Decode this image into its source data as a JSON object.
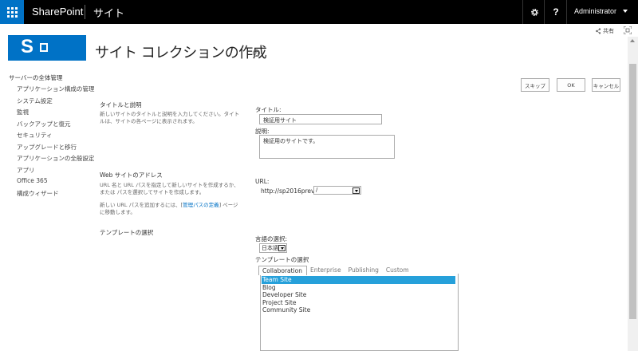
{
  "suitebar": {
    "brand": "SharePoint",
    "site": "サイト",
    "user": "Administrator",
    "help": "?"
  },
  "share_label": "共有",
  "page": {
    "title": "サイト コレクションの作成",
    "info_glyph": "i"
  },
  "leftnav": {
    "heading": "サーバーの全体管理",
    "items": [
      "アプリケーション構成の管理",
      "システム設定",
      "監視",
      "バックアップと復元",
      "セキュリティ",
      "アップグレードと移行",
      "アプリケーションの全般設定",
      "アプリ",
      "Office 365",
      "構成ウィザード"
    ]
  },
  "actions": {
    "skip": "スキップ",
    "ok": "OK",
    "cancel": "キャンセル"
  },
  "sections": {
    "title_desc": {
      "heading": "タイトルと説明",
      "description": "新しいサイトのタイトルと説明を入力してください。タイトルは、サイトの各ページに表示されます。"
    },
    "web_address": {
      "heading": "Web サイトのアドレス",
      "description": "URL 名と URL パスを指定して新しいサイトを作成するか、または パスを選択してサイトを作成します。",
      "description2_pre": "新しい URL パスを追加するには、[",
      "description2_link": "管理パスの定義",
      "description2_post": "] ページに移動します。"
    },
    "template": {
      "heading": "テンプレートの選択"
    }
  },
  "form": {
    "title_label": "タイトル:",
    "title_value": "検証用サイト",
    "desc_label": "説明:",
    "desc_value": "検証用のサイトです。",
    "url_label": "URL:",
    "url_prefix": "http://sp2016prev",
    "url_path": "/",
    "lang_label": "言語の選択:",
    "lang_value": "日本語",
    "tpl_label": "テンプレートの選択"
  },
  "template_tabs": [
    "Collaboration",
    "Enterprise",
    "Publishing",
    "Custom"
  ],
  "template_items": [
    "Team Site",
    "Blog",
    "Developer Site",
    "Project Site",
    "Community Site"
  ],
  "colors": {
    "accent": "#0072c6",
    "selection": "#26a0da",
    "suitebar": "#000000"
  }
}
